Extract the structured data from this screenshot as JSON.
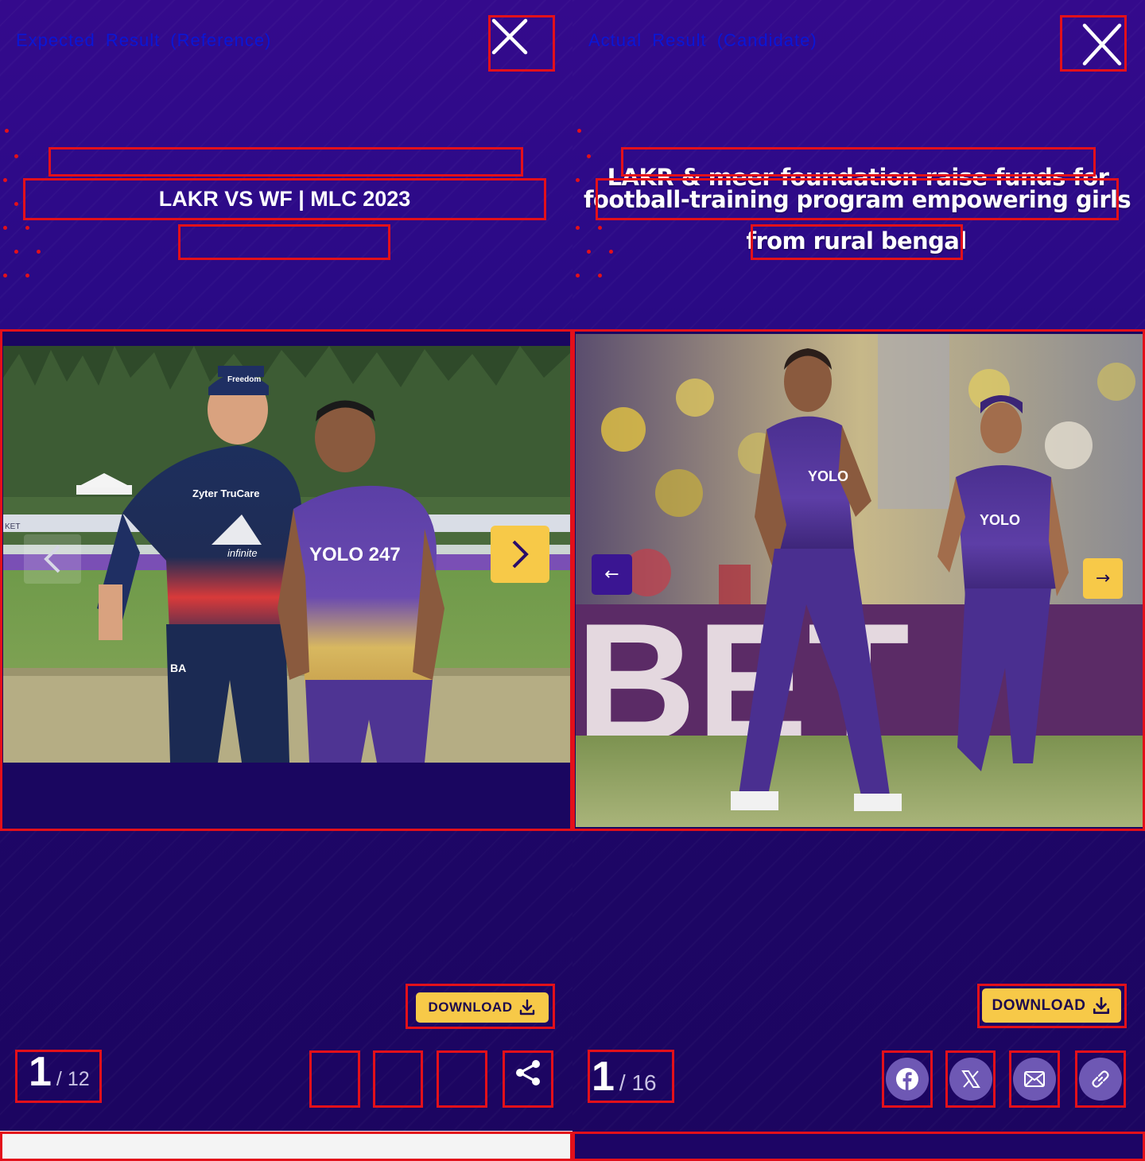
{
  "reference": {
    "label": "Expected Result (Reference)",
    "title_lines": [
      "",
      "LAKR VS WF | MLC 2023",
      ""
    ],
    "counter": {
      "current": "1",
      "total": "/ 12"
    },
    "download_label": "DOWNLOAD",
    "nav": {
      "prev": "chevron-left-icon",
      "next": "chevron-right-icon"
    },
    "share": [
      "share-icon"
    ],
    "photo_text": {
      "cap": "Freedom",
      "chest": "Zyter TruCare",
      "sponsor": "infinite",
      "logo": "YOLO 247",
      "mark": "BA",
      "banner": "KET"
    }
  },
  "candidate": {
    "label": "Actual Result (Candidate)",
    "title_lines": [
      "LAKR & meer foundation raise funds for",
      "football-training program empowering girls",
      "from rural bengal"
    ],
    "counter": {
      "current": "1",
      "total": "/ 16"
    },
    "download_label": "DOWNLOAD",
    "nav": {
      "prev": "←",
      "next": "→"
    },
    "share": [
      "facebook-icon",
      "x-icon",
      "mail-icon",
      "link-icon"
    ],
    "photo_text": {
      "logo": "YOLO",
      "banner": "BET"
    }
  },
  "colors": {
    "highlight": "#e3101a",
    "label": "#0a16d6",
    "accent_yellow": "#f7c948",
    "bg_purple": "#1d0565",
    "icon_circle": "#6e58b4",
    "prev_button": "#3a1592"
  }
}
